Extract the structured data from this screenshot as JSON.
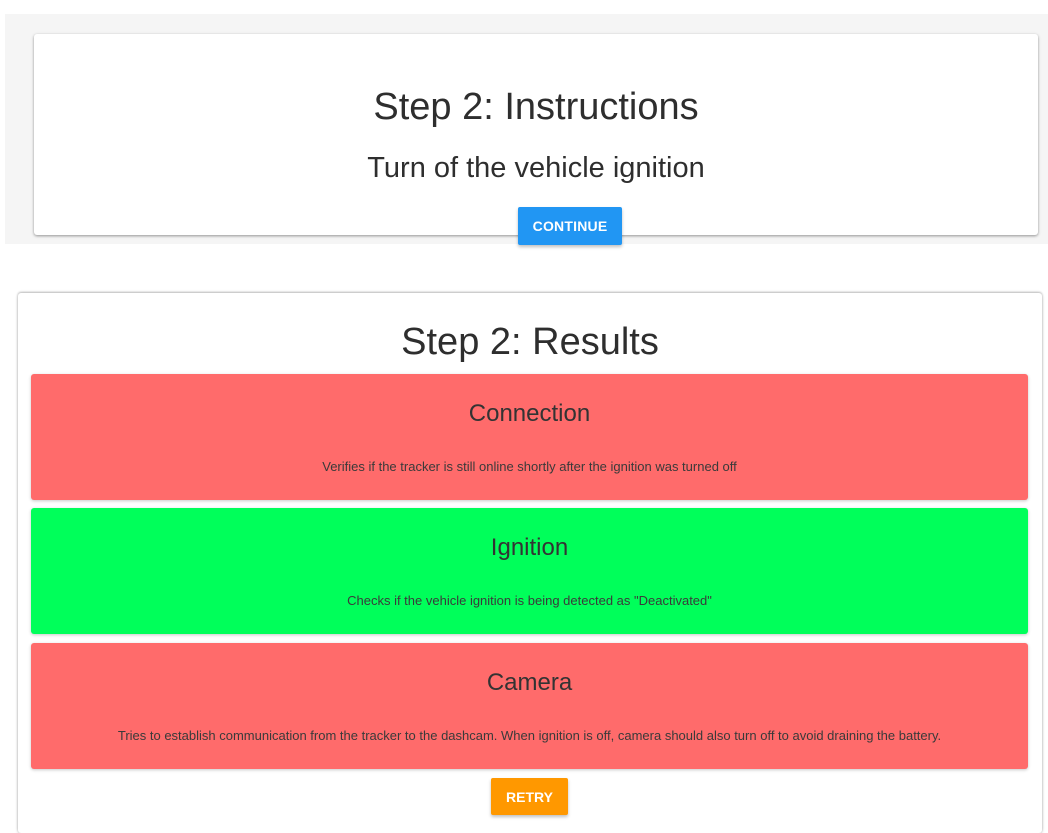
{
  "colors": {
    "fail": "#ff6b6b",
    "pass": "#00ff5a",
    "continue_button": "#2196f3",
    "retry_button": "#ff9800"
  },
  "instructions": {
    "title": "Step 2: Instructions",
    "text": "Turn of the vehicle ignition",
    "continue_label": "CONTINUE"
  },
  "results": {
    "title": "Step 2: Results",
    "items": [
      {
        "name": "Connection",
        "description": "Verifies if the tracker is still online shortly after the ignition was turned off",
        "status": "fail"
      },
      {
        "name": "Ignition",
        "description": "Checks if the vehicle ignition is being detected as \"Deactivated\"",
        "status": "pass"
      },
      {
        "name": "Camera",
        "description": "Tries to establish communication from the tracker to the dashcam. When ignition is off, camera should also turn off to avoid draining the battery.",
        "status": "fail"
      }
    ],
    "retry_label": "RETRY"
  }
}
